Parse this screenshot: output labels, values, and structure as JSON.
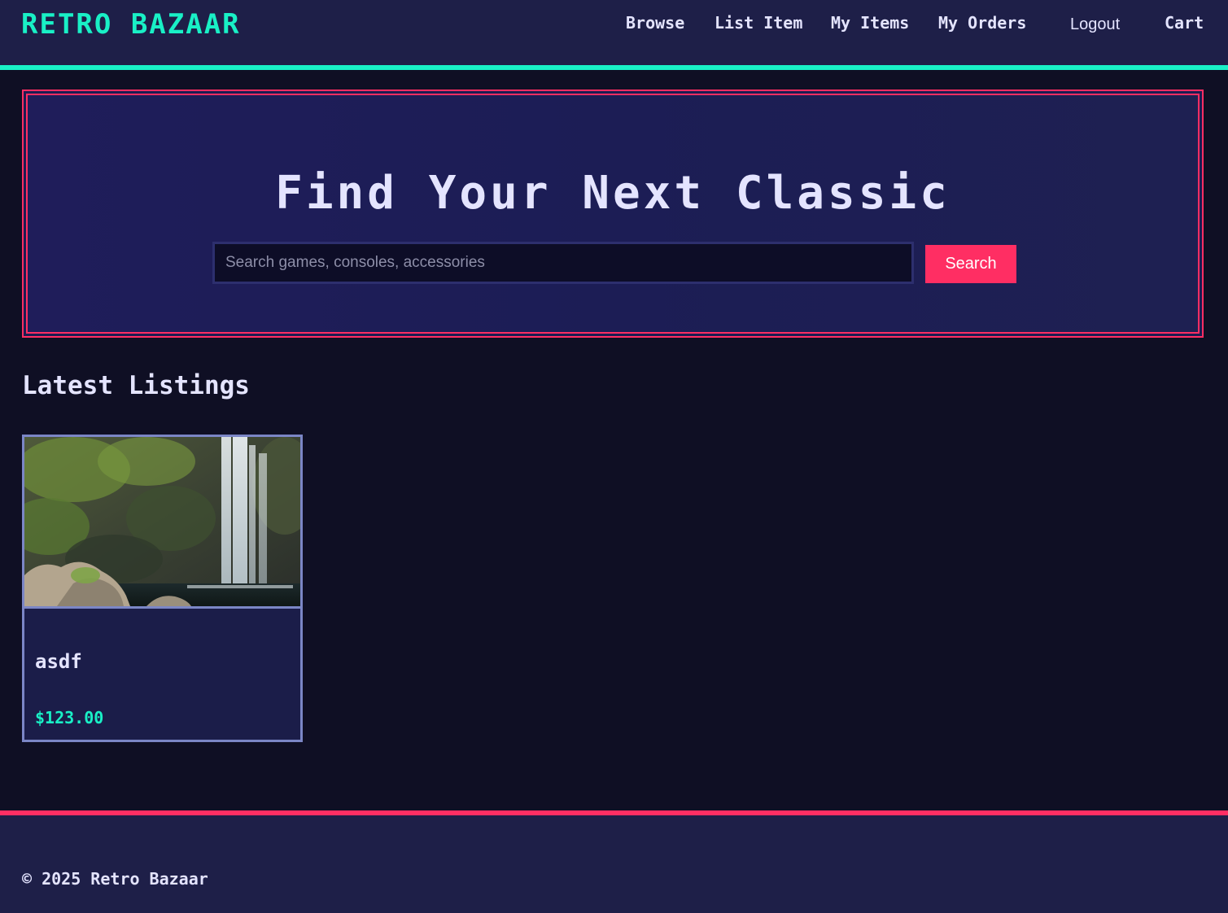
{
  "header": {
    "logo": "RETRO BAZAAR",
    "nav": {
      "browse": "Browse",
      "list_item": "List Item",
      "my_items": "My Items",
      "my_orders": "My Orders",
      "logout": "Logout",
      "cart": "Cart"
    }
  },
  "hero": {
    "title": "Find Your Next Classic",
    "search": {
      "placeholder": "Search games, consoles, accessories",
      "value": "",
      "button_label": "Search"
    }
  },
  "listings": {
    "section_title": "Latest Listings",
    "items": [
      {
        "title": "asdf",
        "price": "$123.00",
        "image_icon": "waterfall-photo"
      }
    ]
  },
  "footer": {
    "copyright": "© 2025 Retro Bazaar"
  },
  "colors": {
    "accent_teal": "#19f0c6",
    "accent_pink": "#ff2e63",
    "panel": "#1e1f48",
    "background": "#0f0f24",
    "card_border": "#7b86c6"
  }
}
